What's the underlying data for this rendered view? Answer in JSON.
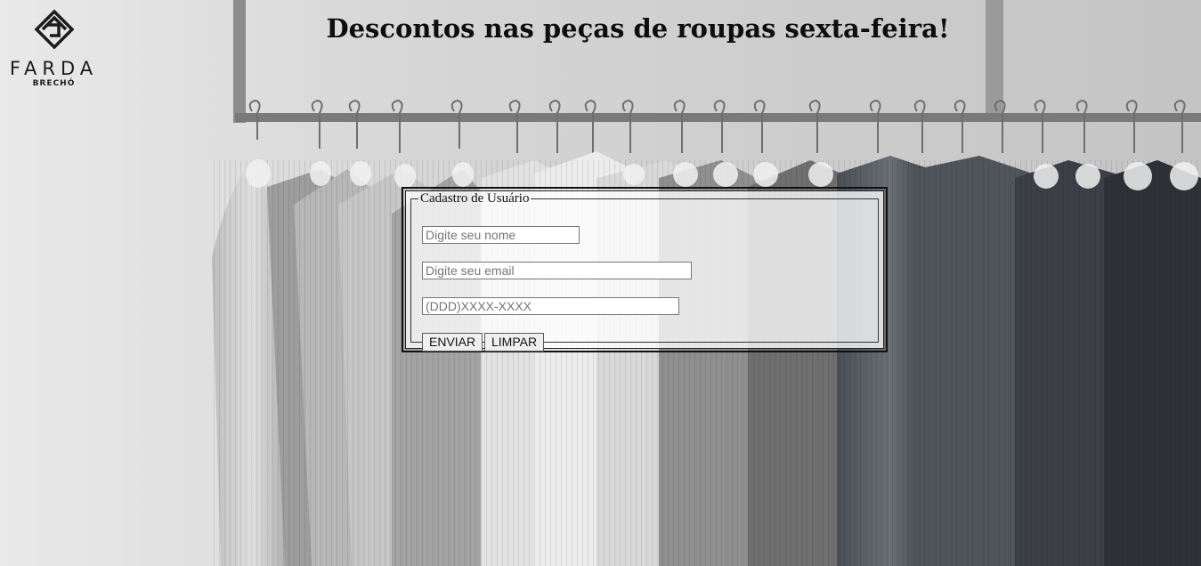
{
  "brand": {
    "name": "FARDA",
    "subtitle": "BRECHÓ",
    "logo_icon": "layered-diamond-icon"
  },
  "headline": "Descontos nas peças de roupas sexta-feira!",
  "form": {
    "legend": "Cadastro de Usuário",
    "name_placeholder": "Digite seu nome",
    "email_placeholder": "Digite seu email",
    "phone_placeholder": "(DDD)XXXX-XXXX",
    "submit_label": "ENVIAR",
    "reset_label": "LIMPAR"
  }
}
